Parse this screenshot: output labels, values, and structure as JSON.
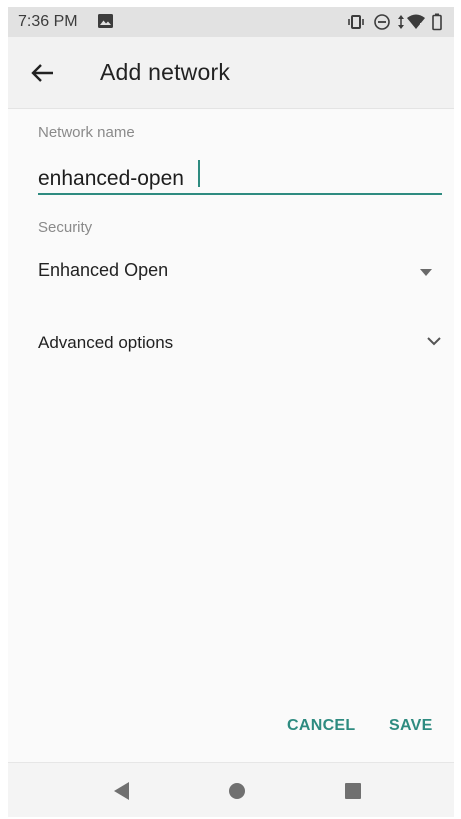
{
  "status_bar": {
    "time": "7:36 PM",
    "icons": [
      "image-icon",
      "vibrate-icon",
      "dnd-icon",
      "data-arrows-icon",
      "wifi-icon",
      "battery-icon"
    ]
  },
  "app_bar": {
    "title": "Add network",
    "back_icon": "arrow-back-icon"
  },
  "form": {
    "network_name_label": "Network name",
    "network_name_value": "enhanced-open",
    "security_label": "Security",
    "security_value": "Enhanced Open",
    "advanced_options_label": "Advanced options"
  },
  "buttons": {
    "cancel": "CANCEL",
    "save": "SAVE"
  },
  "nav_bar": {
    "icons": [
      "nav-back-icon",
      "nav-home-icon",
      "nav-recents-icon"
    ]
  },
  "colors": {
    "accent": "#2e8b80",
    "status_bar_bg": "#e2e2e2",
    "app_bar_bg": "#f2f2f2",
    "background": "#fafafa"
  }
}
